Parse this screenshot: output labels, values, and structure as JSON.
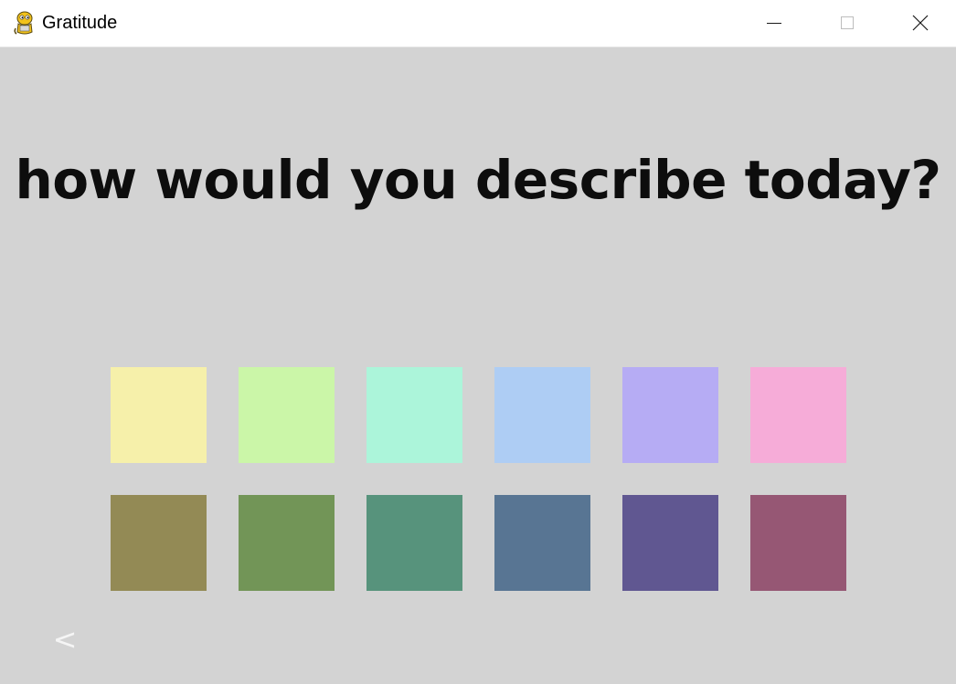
{
  "window": {
    "title": "Gratitude",
    "icon": "python-snake-icon",
    "controls": {
      "minimize": "minimize-icon",
      "maximize": "maximize-icon",
      "close": "close-icon"
    }
  },
  "main": {
    "question": "how would you describe today?",
    "back_label": "<",
    "swatches": {
      "row1": [
        {
          "color": "#f6f0aa"
        },
        {
          "color": "#cbf6a8"
        },
        {
          "color": "#acf5da"
        },
        {
          "color": "#aecdf4"
        },
        {
          "color": "#b6acf4"
        },
        {
          "color": "#f6acd8"
        }
      ],
      "row2": [
        {
          "color": "#938a55"
        },
        {
          "color": "#729557"
        },
        {
          "color": "#57937c"
        },
        {
          "color": "#587593"
        },
        {
          "color": "#605791"
        },
        {
          "color": "#965774"
        }
      ]
    }
  }
}
